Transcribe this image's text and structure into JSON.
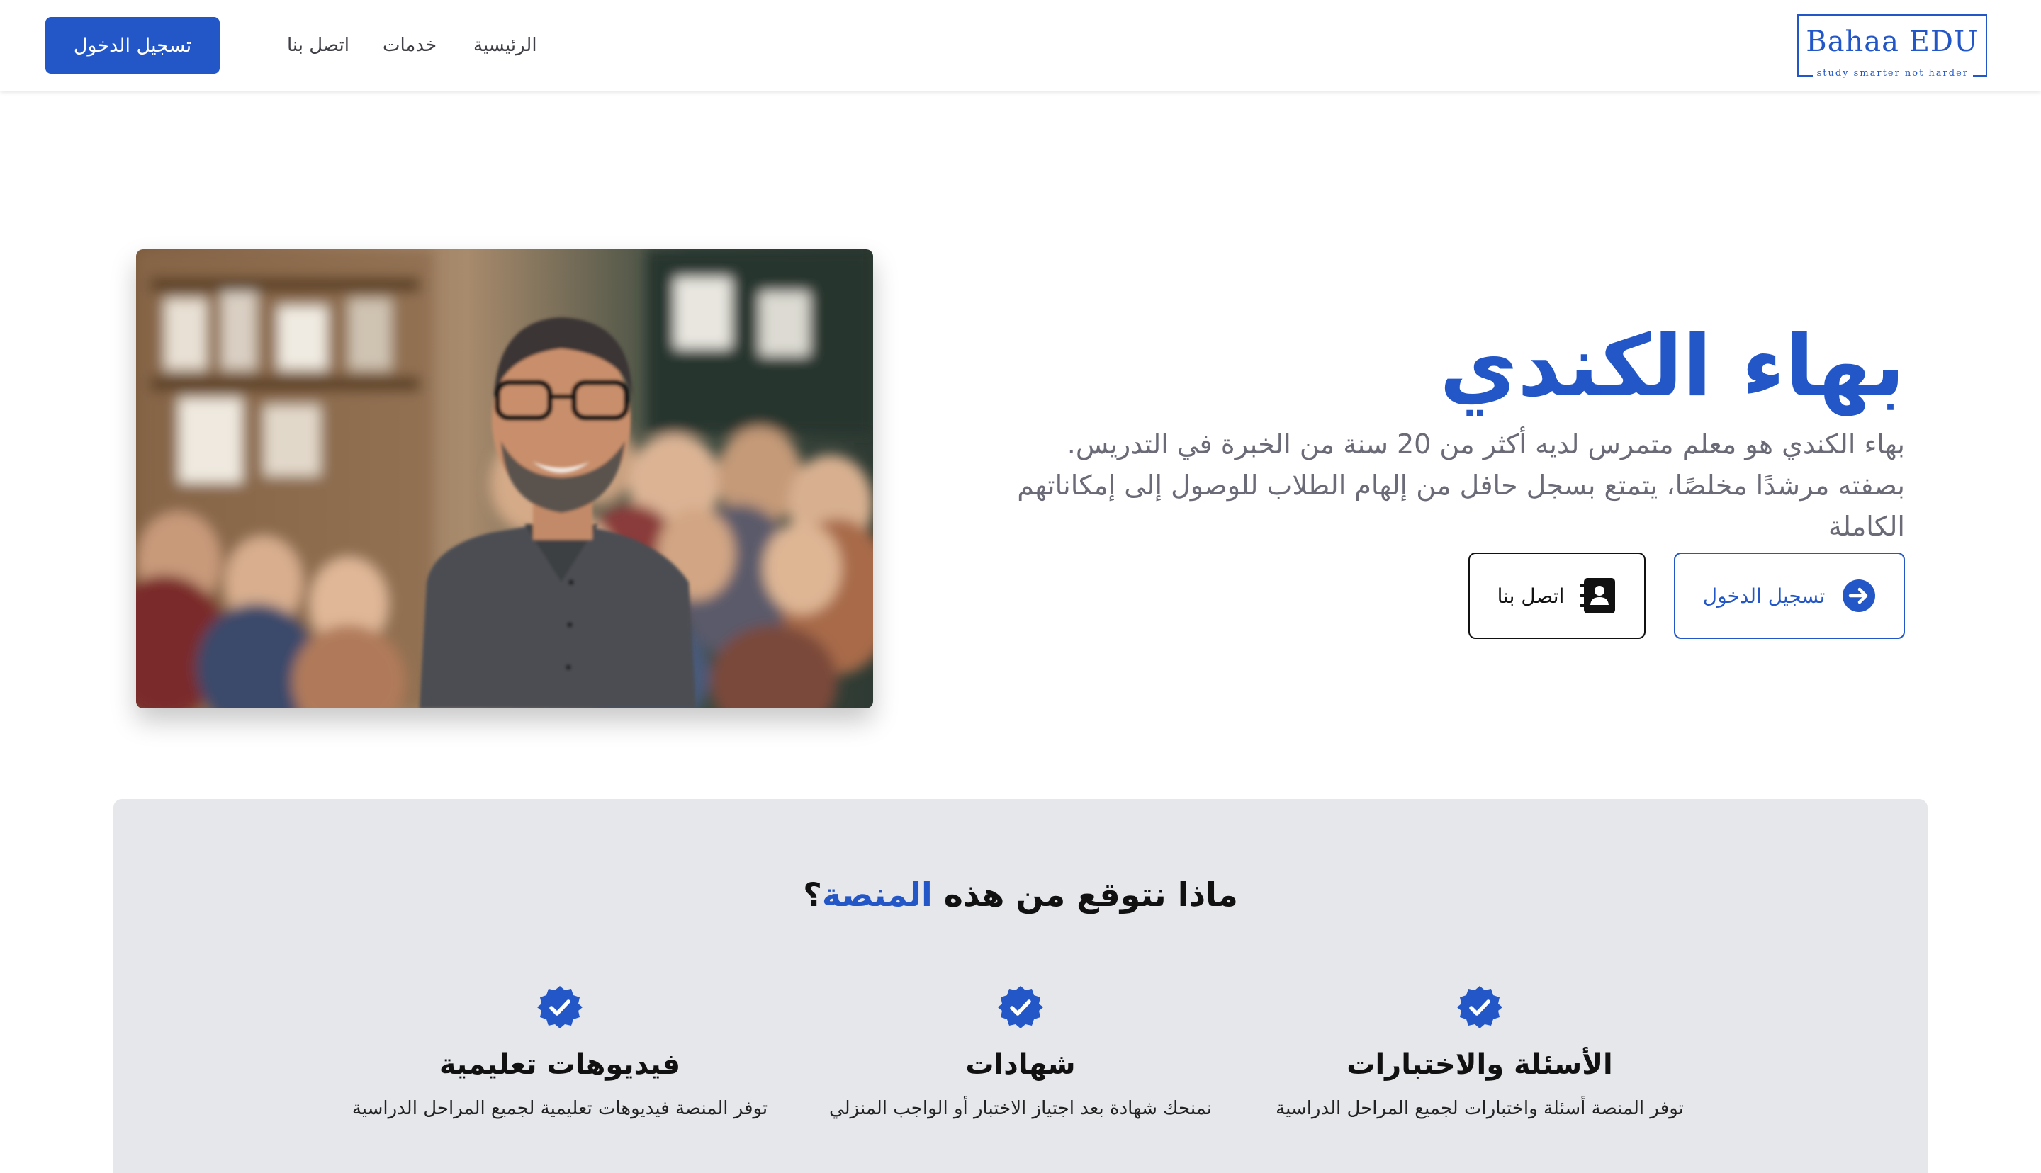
{
  "header": {
    "logo": {
      "name": "Bahaa EDU",
      "tagline": "study smarter not harder"
    },
    "nav": [
      {
        "label": "الرئيسية"
      },
      {
        "label": "خدمات"
      },
      {
        "label": "اتصل بنا"
      }
    ],
    "login_label": "تسجيل الدخول"
  },
  "hero": {
    "title": "بهاء الكندي",
    "description": "بهاء الكندي هو معلم متمرس لديه أكثر من 20 سنة من الخبرة في التدريس. بصفته مرشدًا مخلصًا، يتمتع بسجل حافل من إلهام الطلاب للوصول إلى إمكاناتهم الكاملة",
    "login_button": "تسجيل الدخول",
    "contact_button": "اتصل بنا",
    "login_icon": "arrow-right-circle-icon",
    "contact_icon": "contact-book-icon"
  },
  "features": {
    "title_prefix": "ماذا نتوقع من هذه",
    "title_accent": "المنصة",
    "title_suffix": "؟",
    "items": [
      {
        "icon": "verified-badge-icon",
        "title": "الأسئلة والاختبارات",
        "description": "توفر المنصة أسئلة واختبارات لجميع المراحل الدراسية"
      },
      {
        "icon": "verified-badge-icon",
        "title": "شهادات",
        "description": "نمنحك شهادة بعد اجتياز الاختبار أو الواجب المنزلي"
      },
      {
        "icon": "verified-badge-icon",
        "title": "فيديوهات تعليمية",
        "description": "توفر المنصة فيديوهات تعليمية لجميع المراحل الدراسية"
      }
    ]
  },
  "colors": {
    "primary": "#2357c8",
    "section_bg": "#e6e7eb",
    "text_muted": "#6b6b78"
  }
}
